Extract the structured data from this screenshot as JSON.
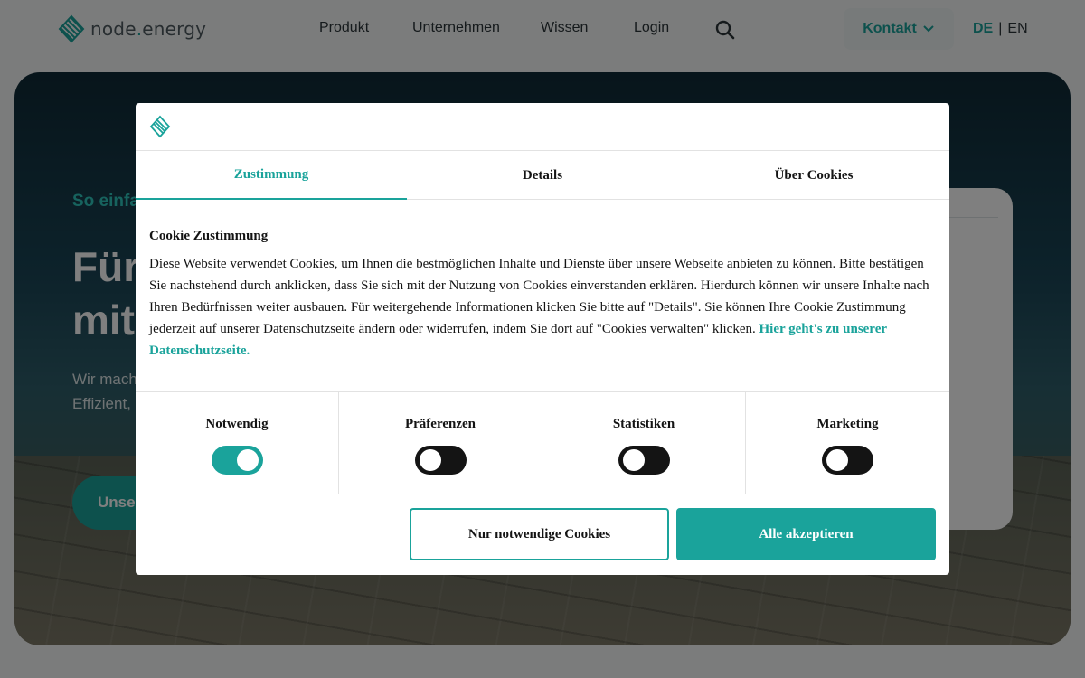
{
  "header": {
    "logo_prefix": "node",
    "logo_dot": ".",
    "logo_suffix": "energy",
    "nav": [
      "Produkt",
      "Unternehmen",
      "Wissen",
      "Login"
    ],
    "search_icon": "search-icon",
    "contact_label": "Kontakt",
    "languages": {
      "active": "DE",
      "separator": "|",
      "other": "EN"
    }
  },
  "hero": {
    "eyebrow": "So einfach geht Energie",
    "title": "Für Energiewende mit uns",
    "text": "Wir machen Energiedaten fit für die Zukunft. Effizient, digital und rechtssicher.",
    "cta": "Unsere Lösungen"
  },
  "cookie_dialog": {
    "tabs": [
      "Zustimmung",
      "Details",
      "Über Cookies"
    ],
    "active_tab": "Zustimmung",
    "heading": "Cookie Zustimmung",
    "body": "Diese Website verwendet Cookies, um Ihnen die bestmöglichen Inhalte und Dienste über unsere Webseite anbieten zu können. Bitte bestätigen Sie nachstehend durch anklicken, dass Sie sich mit der Nutzung von Cookies einverstanden erklären. Hierdurch können wir unsere Inhalte nach Ihren Bedürfnissen weiter ausbauen. Für weitergehende Informationen klicken Sie bitte auf \"Details\". Sie können Ihre Cookie Zustimmung jederzeit auf unserer Datenschutzseite ändern oder widerrufen, indem Sie dort auf \"Cookies verwalten\" klicken.",
    "link_text": "Hier geht's zu unserer Datenschutzseite.",
    "categories": [
      {
        "label": "Notwendig",
        "enabled": true
      },
      {
        "label": "Präferenzen",
        "enabled": false
      },
      {
        "label": "Statistiken",
        "enabled": false
      },
      {
        "label": "Marketing",
        "enabled": false
      }
    ],
    "btn_necessary": "Nur notwendige Cookies",
    "btn_accept": "Alle akzeptieren"
  },
  "colors": {
    "accent": "#1aa39b",
    "text": "#141414",
    "overlay": "rgba(0,0,0,0.5)"
  }
}
